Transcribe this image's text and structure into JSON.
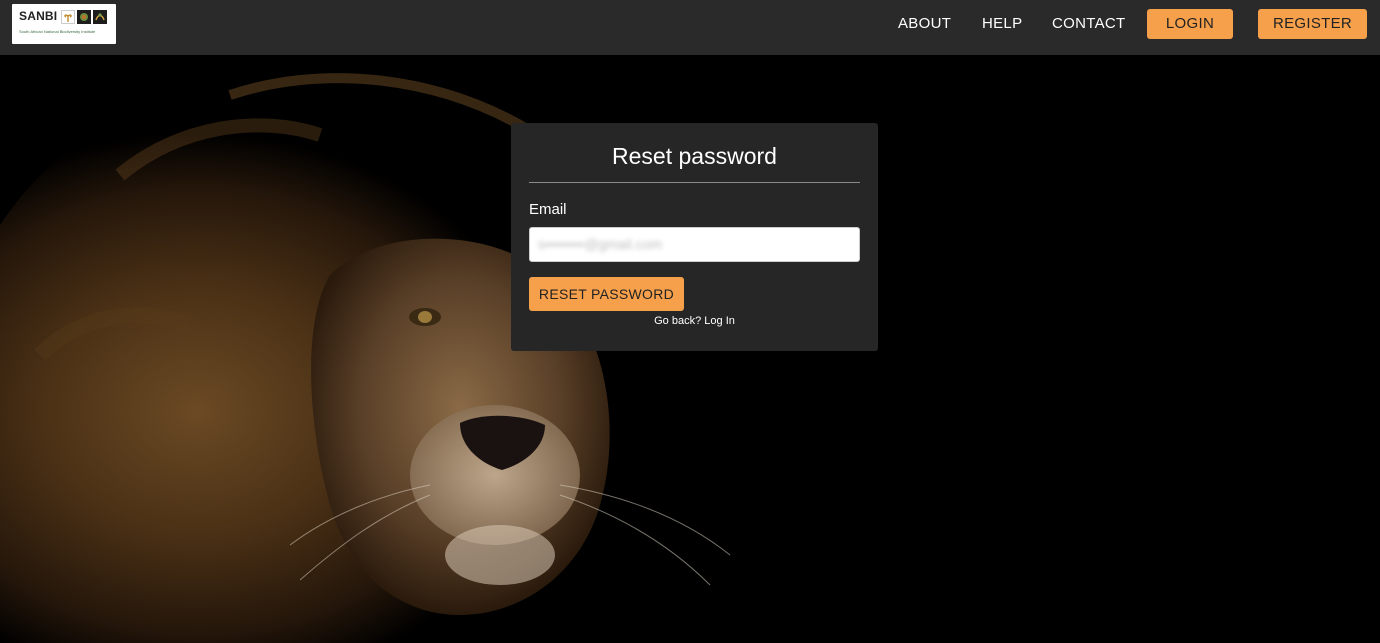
{
  "header": {
    "logo": {
      "name": "SANBI",
      "subtitle": "South African National Biodiversity Institute"
    },
    "nav": {
      "about": "ABOUT",
      "help": "HELP",
      "contact": "CONTACT",
      "login": "LOGIN",
      "register": "REGISTER"
    }
  },
  "card": {
    "title": "Reset password",
    "email_label": "Email",
    "email_value": "s••••••••@gmail.com",
    "reset_button": "RESET PASSWORD",
    "go_back_text": "Go back?",
    "log_in_link": "Log In"
  },
  "colors": {
    "accent": "#f7a04c",
    "navbar": "#2a2a2a",
    "card": "#262626"
  }
}
